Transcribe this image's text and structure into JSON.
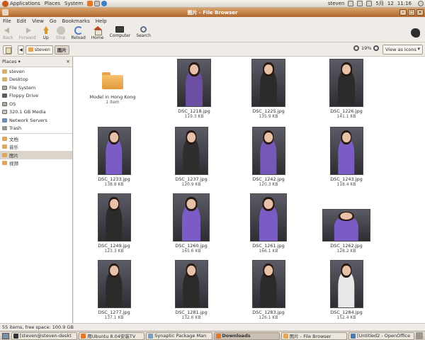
{
  "top_panel": {
    "menus": [
      "Applications",
      "Places",
      "System"
    ],
    "user": "steven",
    "date": "5月",
    "day": "12",
    "time": "11:16"
  },
  "window": {
    "title": "图片 - File Browser"
  },
  "menubar": [
    "File",
    "Edit",
    "View",
    "Go",
    "Bookmarks",
    "Help"
  ],
  "toolbar": {
    "back": "Back",
    "forward": "Forward",
    "up": "Up",
    "stop": "Stop",
    "reload": "Reload",
    "home": "Home",
    "computer": "Computer",
    "search": "Search"
  },
  "location": {
    "crumbs": [
      "steven",
      "图片"
    ],
    "zoom_level": "19%",
    "view_mode": "View as Icons"
  },
  "sidebar": {
    "header": "Places",
    "items": [
      {
        "label": "steven",
        "icon": "home-icon"
      },
      {
        "label": "Desktop",
        "icon": "desktop-icon"
      },
      {
        "label": "File System",
        "icon": "drive-icon"
      },
      {
        "label": "Floppy Drive",
        "icon": "floppy-icon"
      },
      {
        "label": "OS",
        "icon": "drive-icon"
      },
      {
        "label": "320.1 GB Media",
        "icon": "media-icon"
      },
      {
        "label": "Network Servers",
        "icon": "network-icon"
      },
      {
        "label": "Trash",
        "icon": "trash-icon"
      }
    ],
    "bookmarks": [
      {
        "label": "文档",
        "icon": "folder-icon"
      },
      {
        "label": "音乐",
        "icon": "folder-icon"
      },
      {
        "label": "图片",
        "icon": "folder-icon",
        "selected": true
      },
      {
        "label": "视频",
        "icon": "folder-icon"
      }
    ]
  },
  "files": [
    {
      "name": "Model in Hong Kong",
      "size": "1 item",
      "type": "folder"
    },
    {
      "name": "DSC_1218.jpg",
      "size": "119.3 KB",
      "tone": "#6b4fa3"
    },
    {
      "name": "DSC_1225.jpg",
      "size": "135.9 KB",
      "tone": "#2b2b2b"
    },
    {
      "name": "DSC_1226.jpg",
      "size": "141.1 KB",
      "tone": "#2b2b2b"
    },
    {
      "name": "DSC_1233.jpg",
      "size": "138.8 KB",
      "tone": "#7a5cc4"
    },
    {
      "name": "DSC_1237.jpg",
      "size": "120.9 KB",
      "tone": "#2e2e2e"
    },
    {
      "name": "DSC_1242.jpg",
      "size": "120.3 KB",
      "tone": "#7658b8"
    },
    {
      "name": "DSC_1243.jpg",
      "size": "118.4 KB",
      "tone": "#7a5cc4"
    },
    {
      "name": "DSC_1249.jpg",
      "size": "123.3 KB",
      "tone": "#2b2b2b"
    },
    {
      "name": "DSC_1260.jpg",
      "size": "165.6 KB",
      "tone": "#7a5cc4"
    },
    {
      "name": "DSC_1261.jpg",
      "size": "166.1 KB",
      "tone": "#7a5cc4"
    },
    {
      "name": "DSC_1262.jpg",
      "size": "128.2 KB",
      "tone": "#7a5cc4"
    },
    {
      "name": "DSC_1277.jpg",
      "size": "137.1 KB",
      "tone": "#2b2b2b"
    },
    {
      "name": "DSC_1281.jpg",
      "size": "132.6 KB",
      "tone": "#2b2b2b"
    },
    {
      "name": "DSC_1283.jpg",
      "size": "126.1 KB",
      "tone": "#2b2b2b"
    },
    {
      "name": "DSC_1284.jpg",
      "size": "152.4 KB",
      "tone": "#e8e8e8"
    }
  ],
  "status": "55 items, free space: 100.9 GB",
  "taskbar": [
    {
      "label": "[steven@steven-deskt",
      "active": false
    },
    {
      "label": "用Ubuntu 8.04安装TV",
      "active": false
    },
    {
      "label": "Synaptic Package Man",
      "active": false
    },
    {
      "label": "Downloads",
      "active": true
    },
    {
      "label": "图片 - File Browser",
      "active": false
    },
    {
      "label": "[Untitled2 - OpenOffice",
      "active": false
    }
  ]
}
